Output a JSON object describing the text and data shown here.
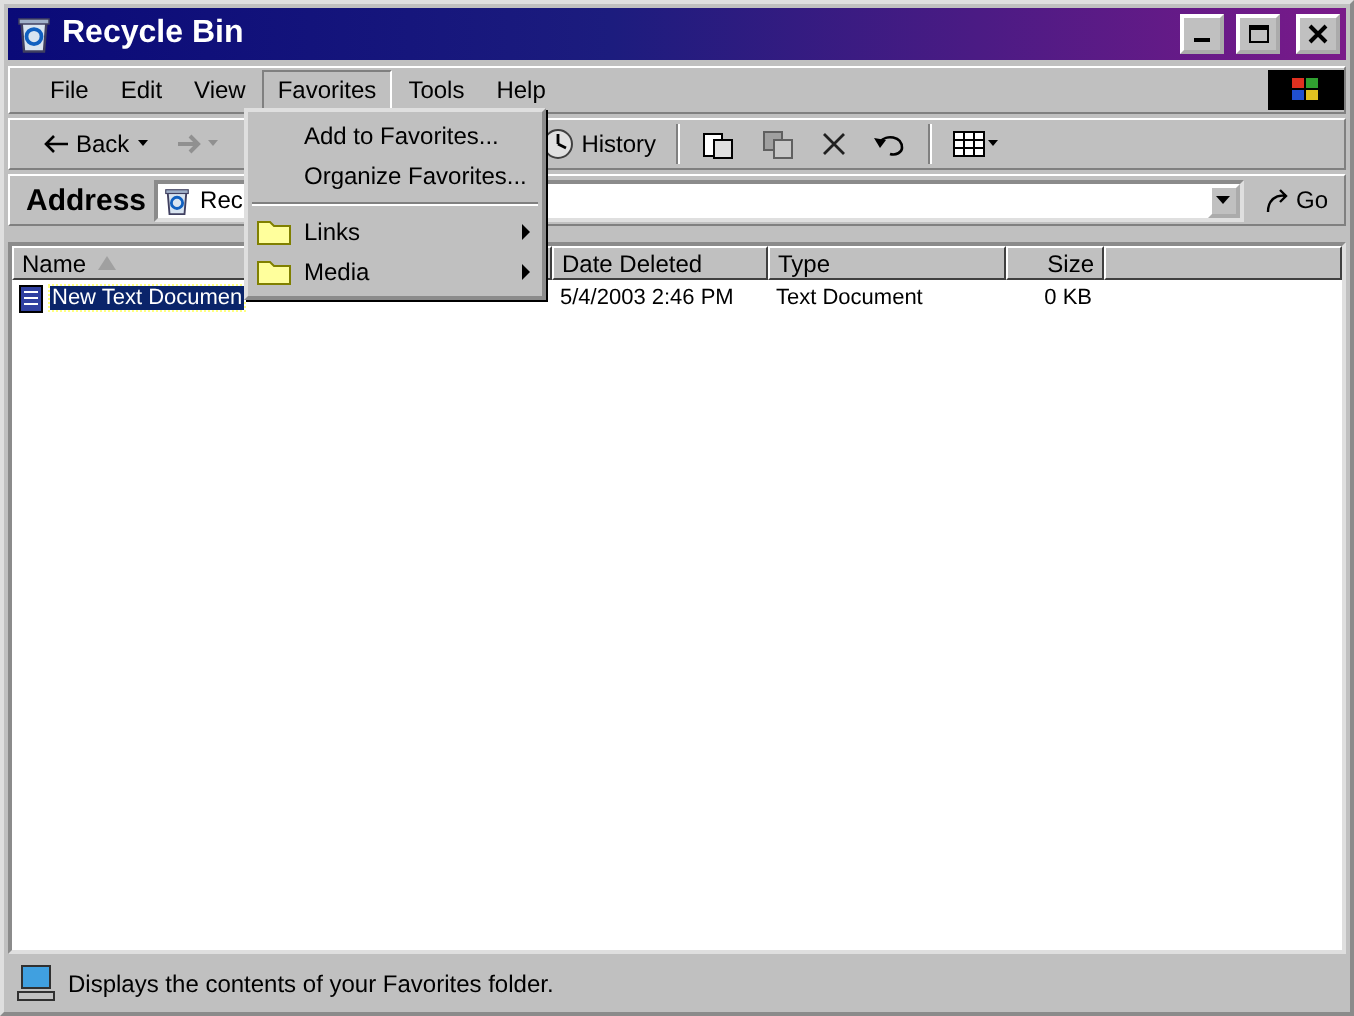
{
  "window": {
    "title": "Recycle Bin"
  },
  "menu_bar": [
    {
      "label": "File",
      "selected": false
    },
    {
      "label": "Edit",
      "selected": false
    },
    {
      "label": "View",
      "selected": false
    },
    {
      "label": "Favorites",
      "selected": true
    },
    {
      "label": "Tools",
      "selected": false
    },
    {
      "label": "Help",
      "selected": false
    }
  ],
  "toolbar": {
    "back": "Back",
    "forward_disabled": true,
    "history": "History"
  },
  "address_bar": {
    "label": "Address",
    "value": "Rec",
    "go": "Go"
  },
  "columns": [
    {
      "label": "Name",
      "sorted": true
    },
    {
      "label": "Date Deleted",
      "sorted": false
    },
    {
      "label": "Type",
      "sorted": false
    },
    {
      "label": "Size",
      "sorted": false
    }
  ],
  "rows": [
    {
      "name": "New Text Documen",
      "date_deleted": "5/4/2003 2:46 PM",
      "type": "Text Document",
      "size": "0 KB",
      "selected": true
    }
  ],
  "favorites_menu": [
    {
      "kind": "command",
      "label": "Add to Favorites..."
    },
    {
      "kind": "command",
      "label": "Organize Favorites..."
    },
    {
      "kind": "separator"
    },
    {
      "kind": "folder",
      "label": "Links"
    },
    {
      "kind": "folder",
      "label": "Media"
    }
  ],
  "status_bar": {
    "text": "Displays the contents of your Favorites folder."
  }
}
